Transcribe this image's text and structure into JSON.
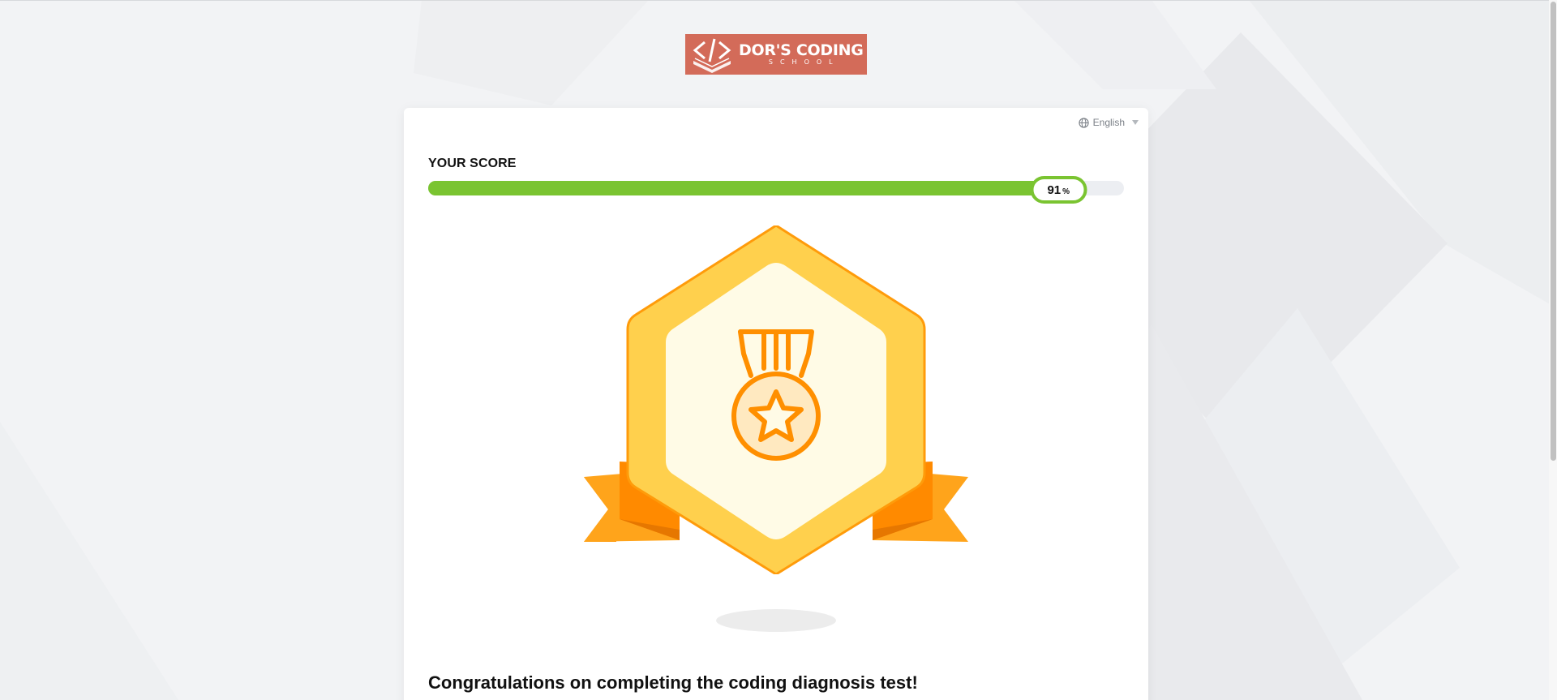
{
  "logo": {
    "title": "DOR'S CODING",
    "subtitle": "SCHOOL"
  },
  "language": {
    "selected": "English",
    "icon": "globe-icon"
  },
  "score": {
    "label": "YOUR SCORE",
    "value": 91,
    "unit": "%"
  },
  "medal": {
    "icon": "medal-star-badge"
  },
  "message": {
    "heading": "Congratulations on completing the coding diagnosis test!"
  },
  "colors": {
    "accent_green": "#7ac431",
    "brand_red": "#d36b59",
    "badge_gold": "#ffd04d",
    "badge_orange": "#ff8f00"
  }
}
